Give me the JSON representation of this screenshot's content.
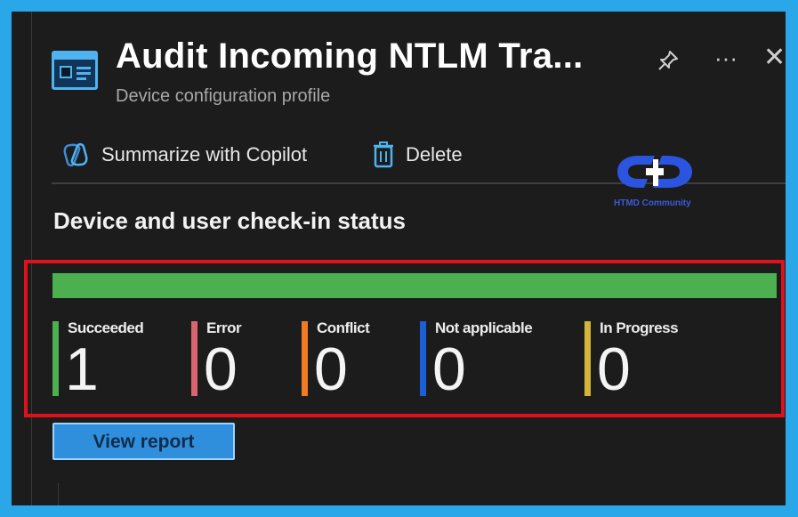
{
  "header": {
    "breadcrumb_fragment": "",
    "title": "Audit Incoming NTLM Tra...",
    "subtitle": "Device configuration profile",
    "pin_icon": "pin-icon",
    "more_label": "···",
    "close_label": "✕"
  },
  "commands": {
    "summarize_label": "Summarize with Copilot",
    "delete_label": "Delete"
  },
  "watermark": {
    "caption": "HTMD Community"
  },
  "section": {
    "title": "Device and user check-in status"
  },
  "progress": {
    "succeeded_fraction": 1.0,
    "color": "#4caf50"
  },
  "stats": [
    {
      "label": "Succeeded",
      "value": "1",
      "color": "#4caf50"
    },
    {
      "label": "Error",
      "value": "0",
      "color": "#d9656f"
    },
    {
      "label": "Conflict",
      "value": "0",
      "color": "#f07b22"
    },
    {
      "label": "Not applicable",
      "value": "0",
      "color": "#1a5fd8"
    },
    {
      "label": "In Progress",
      "value": "0",
      "color": "#d4b53a"
    }
  ],
  "actions": {
    "view_report_label": "View report"
  },
  "colors": {
    "frame": "#29a7e8",
    "panel": "#1c1c1c",
    "highlight_border": "#e0111a",
    "accent": "#2f8fdd"
  }
}
